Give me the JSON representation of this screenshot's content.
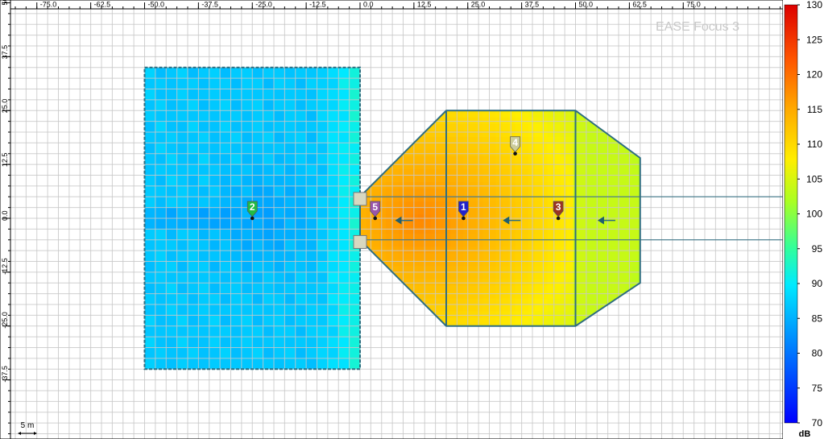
{
  "watermark": "EASE Focus 3",
  "units": "dB",
  "scale_bar_label": "5 m",
  "chart_data": {
    "type": "heatmap",
    "xlim": [
      -81,
      102
    ],
    "ylim": [
      -44,
      56
    ],
    "x_ticks": [
      -75,
      -62.5,
      -50,
      -37.5,
      -25,
      -12.5,
      0,
      12.5,
      25,
      37.5,
      50,
      62.5,
      75
    ],
    "x_tick_labels": [
      "-75.0",
      "-62.5",
      "-50.0",
      "-37.5",
      "-25.0",
      "-12.5",
      "0.0",
      "12.5",
      "25.0",
      "37.5",
      "50.0",
      "62.5",
      "75.0"
    ],
    "y_ticks": [
      50,
      37.5,
      25,
      12.5,
      0,
      -12.5,
      -25,
      -37.5
    ],
    "y_tick_labels": [
      "50.0",
      "37.5",
      "25.0",
      "12.5",
      "0.0",
      "-12.5",
      "-25.0",
      "-37.5"
    ],
    "grid": true,
    "colorbar": {
      "min": 70,
      "max": 130,
      "step": 5,
      "labels": [
        "70",
        "75",
        "80",
        "85",
        "90",
        "95",
        "100",
        "105",
        "110",
        "115",
        "120",
        "125",
        "130"
      ]
    },
    "zones": [
      {
        "id": "audience-left",
        "shape": "rect",
        "x": [
          -50,
          0
        ],
        "y": [
          -35,
          35
        ],
        "level_db": 87
      },
      {
        "id": "audience-right",
        "shape": "polygon",
        "points": [
          [
            0,
            5
          ],
          [
            20,
            25
          ],
          [
            50,
            25
          ],
          [
            65,
            14
          ],
          [
            65,
            -15
          ],
          [
            50,
            -25
          ],
          [
            20,
            -25
          ],
          [
            0,
            -5
          ]
        ],
        "level_db": 110
      }
    ],
    "dividers": [
      [
        20,
        25,
        20,
        -25
      ],
      [
        50,
        25,
        50,
        -25
      ]
    ],
    "beam_lines": [
      {
        "x1": 0,
        "y1": 5,
        "x2": 98,
        "y2": 5
      },
      {
        "x1": 0,
        "y1": -5,
        "x2": 98,
        "y2": -5
      }
    ],
    "direction_arrows": [
      {
        "x": 10,
        "y": -0.5
      },
      {
        "x": 35,
        "y": -0.5
      },
      {
        "x": 57,
        "y": -0.5
      }
    ],
    "stage_boxes": [
      {
        "x": 0,
        "y": 4.5
      },
      {
        "x": 0,
        "y": -5.5
      }
    ],
    "speakers": [
      {
        "label": "1",
        "x": 24,
        "y": 0,
        "color": "#2222cc"
      },
      {
        "label": "2",
        "x": -25,
        "y": 0,
        "color": "#22bb44"
      },
      {
        "label": "3",
        "x": 46,
        "y": 0,
        "color": "#993322"
      },
      {
        "label": "4",
        "x": 36,
        "y": 15,
        "color": "#cccc99"
      },
      {
        "label": "5",
        "x": 3.5,
        "y": 0,
        "color": "#9955aa"
      }
    ]
  }
}
